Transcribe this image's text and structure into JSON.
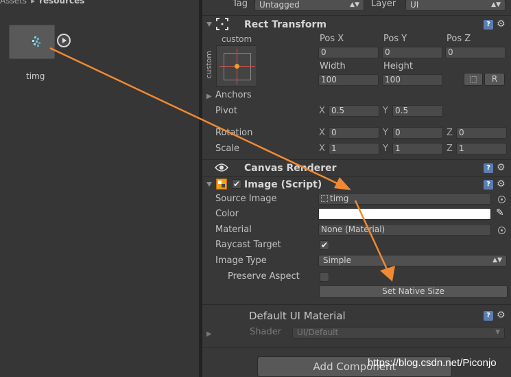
{
  "project": {
    "breadcrumb": [
      "Assets",
      "resources"
    ],
    "breadcrumb_sep": "▸",
    "asset_name": "timg"
  },
  "header": {
    "tag_label": "Tag",
    "tag_value": "Untagged",
    "layer_label": "Layer",
    "layer_value": "UI"
  },
  "rect_transform": {
    "title": "Rect Transform",
    "anchor_preset_top": "custom",
    "anchor_preset_side": "custom",
    "pos_x_label": "Pos X",
    "pos_y_label": "Pos Y",
    "pos_z_label": "Pos Z",
    "pos_x": "0",
    "pos_y": "0",
    "pos_z": "0",
    "width_label": "Width",
    "height_label": "Height",
    "width": "100",
    "height": "100",
    "raw_edit_label": "R",
    "anchors_label": "Anchors",
    "pivot_label": "Pivot",
    "pivot_x": "0.5",
    "pivot_y": "0.5",
    "rotation_label": "Rotation",
    "rotation_x": "0",
    "rotation_y": "0",
    "rotation_z": "0",
    "scale_label": "Scale",
    "scale_x": "1",
    "scale_y": "1",
    "scale_z": "1",
    "axis_x": "X",
    "axis_y": "Y",
    "axis_z": "Z"
  },
  "canvas_renderer": {
    "title": "Canvas Renderer"
  },
  "image_script": {
    "title": "Image (Script)",
    "source_image_label": "Source Image",
    "source_image_value": "timg",
    "color_label": "Color",
    "color_value": "#ffffff",
    "material_label": "Material",
    "material_value": "None (Material)",
    "raycast_label": "Raycast Target",
    "raycast_checked": "✔",
    "image_type_label": "Image Type",
    "image_type_value": "Simple",
    "preserve_aspect_label": "Preserve Aspect",
    "set_native_size_label": "Set Native Size"
  },
  "material_section": {
    "title": "Default UI Material",
    "shader_label": "Shader",
    "shader_value": "UI/Default"
  },
  "add_component_label": "Add Component",
  "watermark": "https://blog.csdn.net/Piconjo",
  "colors": {
    "arrow": "#f08a32",
    "help": "#5b7eb0"
  }
}
